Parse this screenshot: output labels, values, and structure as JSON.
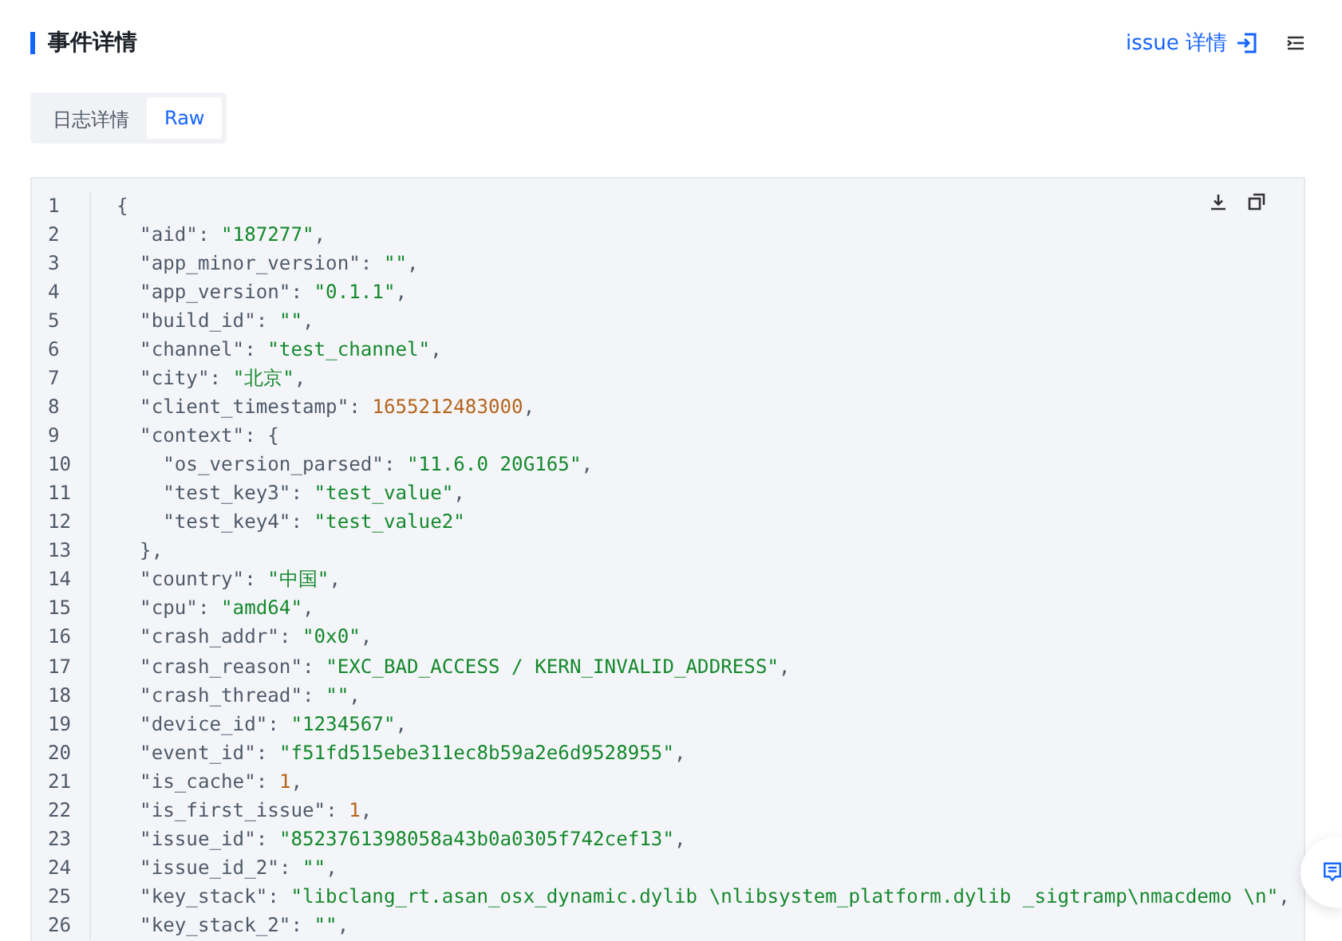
{
  "header": {
    "title": "事件详情",
    "link": "issue 详情"
  },
  "tabs": [
    {
      "label": "日志详情",
      "selected": false
    },
    {
      "label": "Raw",
      "selected": true
    }
  ],
  "code": {
    "lines": [
      {
        "number": "1",
        "parts": [
          {
            "kind": "punct",
            "text": "{"
          }
        ]
      },
      {
        "number": "2",
        "parts": [
          {
            "kind": "key",
            "text": "  \"aid\""
          },
          {
            "kind": "punct",
            "text": ": "
          },
          {
            "kind": "string",
            "text": "\"187277\""
          },
          {
            "kind": "punct",
            "text": ","
          }
        ]
      },
      {
        "number": "3",
        "parts": [
          {
            "kind": "key",
            "text": "  \"app_minor_version\""
          },
          {
            "kind": "punct",
            "text": ": "
          },
          {
            "kind": "string",
            "text": "\"\""
          },
          {
            "kind": "punct",
            "text": ","
          }
        ]
      },
      {
        "number": "4",
        "parts": [
          {
            "kind": "key",
            "text": "  \"app_version\""
          },
          {
            "kind": "punct",
            "text": ": "
          },
          {
            "kind": "string",
            "text": "\"0.1.1\""
          },
          {
            "kind": "punct",
            "text": ","
          }
        ]
      },
      {
        "number": "5",
        "parts": [
          {
            "kind": "key",
            "text": "  \"build_id\""
          },
          {
            "kind": "punct",
            "text": ": "
          },
          {
            "kind": "string",
            "text": "\"\""
          },
          {
            "kind": "punct",
            "text": ","
          }
        ]
      },
      {
        "number": "6",
        "parts": [
          {
            "kind": "key",
            "text": "  \"channel\""
          },
          {
            "kind": "punct",
            "text": ": "
          },
          {
            "kind": "string",
            "text": "\"test_channel\""
          },
          {
            "kind": "punct",
            "text": ","
          }
        ]
      },
      {
        "number": "7",
        "parts": [
          {
            "kind": "key",
            "text": "  \"city\""
          },
          {
            "kind": "punct",
            "text": ": "
          },
          {
            "kind": "string",
            "text": "\"北京\""
          },
          {
            "kind": "punct",
            "text": ","
          }
        ]
      },
      {
        "number": "8",
        "parts": [
          {
            "kind": "key",
            "text": "  \"client_timestamp\""
          },
          {
            "kind": "punct",
            "text": ": "
          },
          {
            "kind": "number",
            "text": "1655212483000"
          },
          {
            "kind": "punct",
            "text": ","
          }
        ]
      },
      {
        "number": "9",
        "parts": [
          {
            "kind": "key",
            "text": "  \"context\""
          },
          {
            "kind": "punct",
            "text": ": {"
          }
        ]
      },
      {
        "number": "10",
        "parts": [
          {
            "kind": "key",
            "text": "    \"os_version_parsed\""
          },
          {
            "kind": "punct",
            "text": ": "
          },
          {
            "kind": "string",
            "text": "\"11.6.0 20G165\""
          },
          {
            "kind": "punct",
            "text": ","
          }
        ]
      },
      {
        "number": "11",
        "parts": [
          {
            "kind": "key",
            "text": "    \"test_key3\""
          },
          {
            "kind": "punct",
            "text": ": "
          },
          {
            "kind": "string",
            "text": "\"test_value\""
          },
          {
            "kind": "punct",
            "text": ","
          }
        ]
      },
      {
        "number": "12",
        "parts": [
          {
            "kind": "key",
            "text": "    \"test_key4\""
          },
          {
            "kind": "punct",
            "text": ": "
          },
          {
            "kind": "string",
            "text": "\"test_value2\""
          }
        ]
      },
      {
        "number": "13",
        "parts": [
          {
            "kind": "punct",
            "text": "  },"
          }
        ]
      },
      {
        "number": "14",
        "parts": [
          {
            "kind": "key",
            "text": "  \"country\""
          },
          {
            "kind": "punct",
            "text": ": "
          },
          {
            "kind": "string",
            "text": "\"中国\""
          },
          {
            "kind": "punct",
            "text": ","
          }
        ]
      },
      {
        "number": "15",
        "parts": [
          {
            "kind": "key",
            "text": "  \"cpu\""
          },
          {
            "kind": "punct",
            "text": ": "
          },
          {
            "kind": "string",
            "text": "\"amd64\""
          },
          {
            "kind": "punct",
            "text": ","
          }
        ]
      },
      {
        "number": "16",
        "parts": [
          {
            "kind": "key",
            "text": "  \"crash_addr\""
          },
          {
            "kind": "punct",
            "text": ": "
          },
          {
            "kind": "string",
            "text": "\"0x0\""
          },
          {
            "kind": "punct",
            "text": ","
          }
        ]
      },
      {
        "number": "17",
        "parts": [
          {
            "kind": "key",
            "text": "  \"crash_reason\""
          },
          {
            "kind": "punct",
            "text": ": "
          },
          {
            "kind": "string",
            "text": "\"EXC_BAD_ACCESS / KERN_INVALID_ADDRESS\""
          },
          {
            "kind": "punct",
            "text": ","
          }
        ]
      },
      {
        "number": "18",
        "parts": [
          {
            "kind": "key",
            "text": "  \"crash_thread\""
          },
          {
            "kind": "punct",
            "text": ": "
          },
          {
            "kind": "string",
            "text": "\"\""
          },
          {
            "kind": "punct",
            "text": ","
          }
        ]
      },
      {
        "number": "19",
        "parts": [
          {
            "kind": "key",
            "text": "  \"device_id\""
          },
          {
            "kind": "punct",
            "text": ": "
          },
          {
            "kind": "string",
            "text": "\"1234567\""
          },
          {
            "kind": "punct",
            "text": ","
          }
        ]
      },
      {
        "number": "20",
        "parts": [
          {
            "kind": "key",
            "text": "  \"event_id\""
          },
          {
            "kind": "punct",
            "text": ": "
          },
          {
            "kind": "string",
            "text": "\"f51fd515ebe311ec8b59a2e6d9528955\""
          },
          {
            "kind": "punct",
            "text": ","
          }
        ]
      },
      {
        "number": "21",
        "parts": [
          {
            "kind": "key",
            "text": "  \"is_cache\""
          },
          {
            "kind": "punct",
            "text": ": "
          },
          {
            "kind": "number",
            "text": "1"
          },
          {
            "kind": "punct",
            "text": ","
          }
        ]
      },
      {
        "number": "22",
        "parts": [
          {
            "kind": "key",
            "text": "  \"is_first_issue\""
          },
          {
            "kind": "punct",
            "text": ": "
          },
          {
            "kind": "number",
            "text": "1"
          },
          {
            "kind": "punct",
            "text": ","
          }
        ]
      },
      {
        "number": "23",
        "parts": [
          {
            "kind": "key",
            "text": "  \"issue_id\""
          },
          {
            "kind": "punct",
            "text": ": "
          },
          {
            "kind": "string",
            "text": "\"8523761398058a43b0a0305f742cef13\""
          },
          {
            "kind": "punct",
            "text": ","
          }
        ]
      },
      {
        "number": "24",
        "parts": [
          {
            "kind": "key",
            "text": "  \"issue_id_2\""
          },
          {
            "kind": "punct",
            "text": ": "
          },
          {
            "kind": "string",
            "text": "\"\""
          },
          {
            "kind": "punct",
            "text": ","
          }
        ]
      },
      {
        "number": "25",
        "parts": [
          {
            "kind": "key",
            "text": "  \"key_stack\""
          },
          {
            "kind": "punct",
            "text": ": "
          },
          {
            "kind": "string",
            "text": "\"libclang_rt.asan_osx_dynamic.dylib \\nlibsystem_platform.dylib _sigtramp\\nmacdemo \\n\""
          },
          {
            "kind": "punct",
            "text": ","
          }
        ]
      },
      {
        "number": "26",
        "parts": [
          {
            "kind": "key",
            "text": "  \"key_stack_2\""
          },
          {
            "kind": "punct",
            "text": ": "
          },
          {
            "kind": "string",
            "text": "\"\""
          },
          {
            "kind": "punct",
            "text": ","
          }
        ]
      }
    ]
  }
}
